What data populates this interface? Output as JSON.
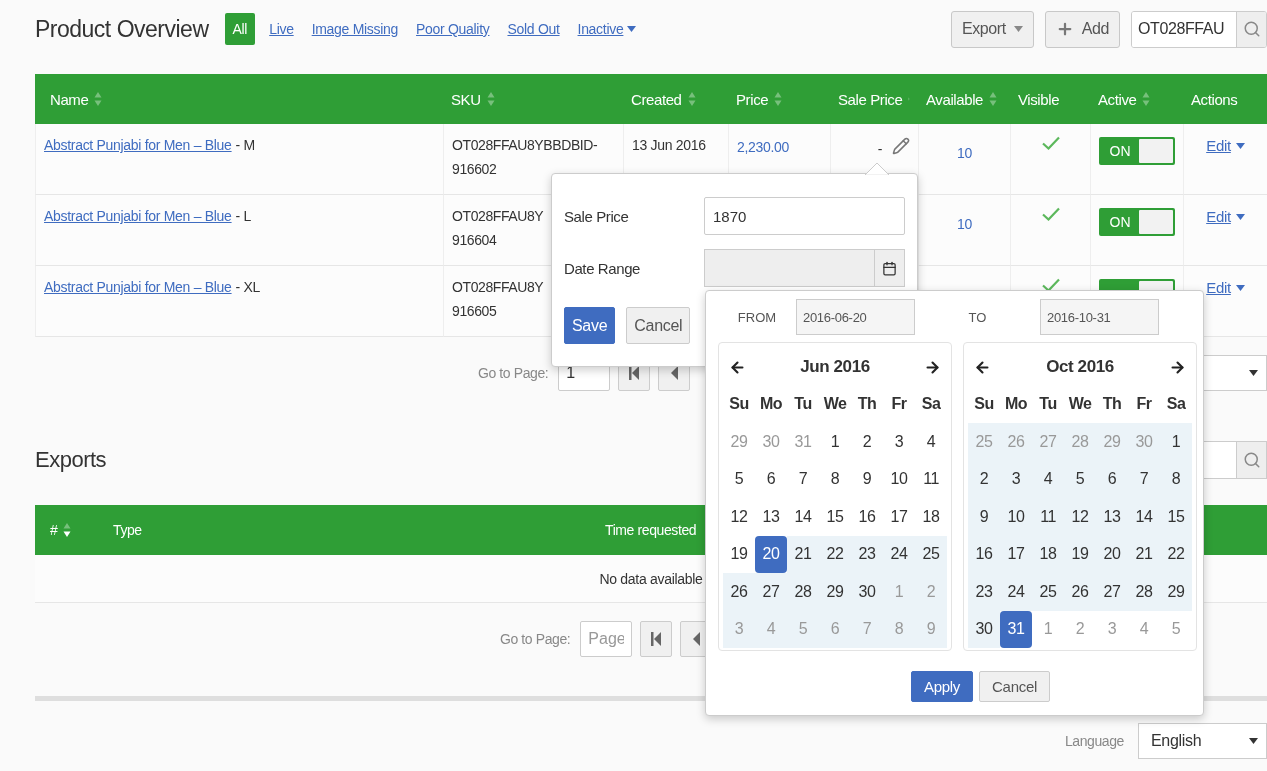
{
  "header": {
    "title": "Product Overview",
    "filters": [
      {
        "label": "All",
        "selected": true,
        "menu": false
      },
      {
        "label": "Live",
        "selected": false,
        "menu": false
      },
      {
        "label": "Image Missing",
        "selected": false,
        "menu": false
      },
      {
        "label": "Poor Quality",
        "selected": false,
        "menu": false
      },
      {
        "label": "Sold Out",
        "selected": false,
        "menu": false
      },
      {
        "label": "Inactive",
        "selected": false,
        "menu": true
      }
    ],
    "actions": [
      {
        "label": "Export",
        "kind": "dropdown"
      },
      {
        "label": "Add",
        "kind": "add"
      }
    ],
    "search": {
      "value": "OT028FFAU"
    }
  },
  "products": {
    "columns": [
      {
        "label": "Name",
        "sortable": true
      },
      {
        "label": "SKU",
        "sortable": true
      },
      {
        "label": "Created",
        "sortable": true
      },
      {
        "label": "Price",
        "sortable": true
      },
      {
        "label": "Sale Price",
        "sortable": true
      },
      {
        "label": "Available",
        "sortable": true
      },
      {
        "label": "Visible",
        "sortable": false
      },
      {
        "label": "Active",
        "sortable": true
      },
      {
        "label": "Actions",
        "sortable": false
      }
    ],
    "rows": [
      {
        "name": "Abstract Punjabi for Men – Blue",
        "size": "- M",
        "sku": [
          "OT028FFAU8YBBDBID-",
          "916602"
        ],
        "created": "13 Jun 2016",
        "price": "2,230.00",
        "sale_price": "-",
        "available": "10",
        "visible": true,
        "active": true,
        "active_label": "ON",
        "action": "Edit"
      },
      {
        "name": "Abstract Punjabi for Men – Blue",
        "size": "- L",
        "sku": [
          "OT028FFAU8Y",
          "916604"
        ],
        "available": "10",
        "visible": true,
        "active": true,
        "active_label": "ON",
        "action": "Edit"
      },
      {
        "name": "Abstract Punjabi for Men – Blue",
        "size": "- XL",
        "sku": [
          "OT028FFAU8Y",
          "916605"
        ],
        "visible": true,
        "active": true,
        "action": "Edit"
      }
    ],
    "pagination": {
      "label": "Go to Page:",
      "value": "1"
    }
  },
  "exports": {
    "title": "Exports",
    "columns": [
      {
        "label": "#",
        "sortable": true,
        "sorted_desc": true
      },
      {
        "label": "Type",
        "sortable": false
      },
      {
        "label": "Time requested",
        "sortable": false
      }
    ],
    "empty": "No data available",
    "pagination": {
      "label": "Go to Page:",
      "placeholder": "Page"
    }
  },
  "footer": {
    "label": "Language",
    "value": "English"
  },
  "sale_popover": {
    "fields": [
      {
        "label": "Sale Price",
        "kind": "text",
        "value": "1870"
      },
      {
        "label": "Date Range",
        "kind": "date"
      }
    ],
    "buttons": [
      {
        "label": "Save",
        "kind": "primary"
      },
      {
        "label": "Cancel",
        "kind": "default"
      }
    ]
  },
  "datepicker": {
    "from_label": "FROM",
    "from": "2016-06-20",
    "to_label": "TO",
    "to": "2016-10-31",
    "calendars": [
      {
        "title": "Jun 2016",
        "weekdays": [
          "Su",
          "Mo",
          "Tu",
          "We",
          "Th",
          "Fr",
          "Sa"
        ],
        "weeks": [
          [
            {
              "day": "29",
              "muted": true,
              "in_range": false,
              "selected": false
            },
            {
              "day": "30",
              "muted": true,
              "in_range": false,
              "selected": false
            },
            {
              "day": "31",
              "muted": true,
              "in_range": false,
              "selected": false
            },
            {
              "day": "1",
              "muted": false,
              "in_range": false,
              "selected": false
            },
            {
              "day": "2",
              "muted": false,
              "in_range": false,
              "selected": false
            },
            {
              "day": "3",
              "muted": false,
              "in_range": false,
              "selected": false
            },
            {
              "day": "4",
              "muted": false,
              "in_range": false,
              "selected": false
            }
          ],
          [
            {
              "day": "5",
              "muted": false,
              "in_range": false,
              "selected": false
            },
            {
              "day": "6",
              "muted": false,
              "in_range": false,
              "selected": false
            },
            {
              "day": "7",
              "muted": false,
              "in_range": false,
              "selected": false
            },
            {
              "day": "8",
              "muted": false,
              "in_range": false,
              "selected": false
            },
            {
              "day": "9",
              "muted": false,
              "in_range": false,
              "selected": false
            },
            {
              "day": "10",
              "muted": false,
              "in_range": false,
              "selected": false
            },
            {
              "day": "11",
              "muted": false,
              "in_range": false,
              "selected": false
            }
          ],
          [
            {
              "day": "12",
              "muted": false,
              "in_range": false,
              "selected": false
            },
            {
              "day": "13",
              "muted": false,
              "in_range": false,
              "selected": false
            },
            {
              "day": "14",
              "muted": false,
              "in_range": false,
              "selected": false
            },
            {
              "day": "15",
              "muted": false,
              "in_range": false,
              "selected": false
            },
            {
              "day": "16",
              "muted": false,
              "in_range": false,
              "selected": false
            },
            {
              "day": "17",
              "muted": false,
              "in_range": false,
              "selected": false
            },
            {
              "day": "18",
              "muted": false,
              "in_range": false,
              "selected": false
            }
          ],
          [
            {
              "day": "19",
              "muted": false,
              "in_range": false,
              "selected": false
            },
            {
              "day": "20",
              "muted": false,
              "in_range": true,
              "selected": true
            },
            {
              "day": "21",
              "muted": false,
              "in_range": true,
              "selected": false
            },
            {
              "day": "22",
              "muted": false,
              "in_range": true,
              "selected": false
            },
            {
              "day": "23",
              "muted": false,
              "in_range": true,
              "selected": false
            },
            {
              "day": "24",
              "muted": false,
              "in_range": true,
              "selected": false
            },
            {
              "day": "25",
              "muted": false,
              "in_range": true,
              "selected": false
            }
          ],
          [
            {
              "day": "26",
              "muted": false,
              "in_range": true,
              "selected": false
            },
            {
              "day": "27",
              "muted": false,
              "in_range": true,
              "selected": false
            },
            {
              "day": "28",
              "muted": false,
              "in_range": true,
              "selected": false
            },
            {
              "day": "29",
              "muted": false,
              "in_range": true,
              "selected": false
            },
            {
              "day": "30",
              "muted": false,
              "in_range": true,
              "selected": false
            },
            {
              "day": "1",
              "muted": true,
              "in_range": true,
              "selected": false
            },
            {
              "day": "2",
              "muted": true,
              "in_range": true,
              "selected": false
            }
          ],
          [
            {
              "day": "3",
              "muted": true,
              "in_range": true,
              "selected": false
            },
            {
              "day": "4",
              "muted": true,
              "in_range": true,
              "selected": false
            },
            {
              "day": "5",
              "muted": true,
              "in_range": true,
              "selected": false
            },
            {
              "day": "6",
              "muted": true,
              "in_range": true,
              "selected": false
            },
            {
              "day": "7",
              "muted": true,
              "in_range": true,
              "selected": false
            },
            {
              "day": "8",
              "muted": true,
              "in_range": true,
              "selected": false
            },
            {
              "day": "9",
              "muted": true,
              "in_range": true,
              "selected": false
            }
          ]
        ]
      },
      {
        "title": "Oct 2016",
        "weekdays": [
          "Su",
          "Mo",
          "Tu",
          "We",
          "Th",
          "Fr",
          "Sa"
        ],
        "weeks": [
          [
            {
              "day": "25",
              "muted": true,
              "in_range": true,
              "selected": false
            },
            {
              "day": "26",
              "muted": true,
              "in_range": true,
              "selected": false
            },
            {
              "day": "27",
              "muted": true,
              "in_range": true,
              "selected": false
            },
            {
              "day": "28",
              "muted": true,
              "in_range": true,
              "selected": false
            },
            {
              "day": "29",
              "muted": true,
              "in_range": true,
              "selected": false
            },
            {
              "day": "30",
              "muted": true,
              "in_range": true,
              "selected": false
            },
            {
              "day": "1",
              "muted": false,
              "in_range": true,
              "selected": false
            }
          ],
          [
            {
              "day": "2",
              "muted": false,
              "in_range": true,
              "selected": false
            },
            {
              "day": "3",
              "muted": false,
              "in_range": true,
              "selected": false
            },
            {
              "day": "4",
              "muted": false,
              "in_range": true,
              "selected": false
            },
            {
              "day": "5",
              "muted": false,
              "in_range": true,
              "selected": false
            },
            {
              "day": "6",
              "muted": false,
              "in_range": true,
              "selected": false
            },
            {
              "day": "7",
              "muted": false,
              "in_range": true,
              "selected": false
            },
            {
              "day": "8",
              "muted": false,
              "in_range": true,
              "selected": false
            }
          ],
          [
            {
              "day": "9",
              "muted": false,
              "in_range": true,
              "selected": false
            },
            {
              "day": "10",
              "muted": false,
              "in_range": true,
              "selected": false
            },
            {
              "day": "11",
              "muted": false,
              "in_range": true,
              "selected": false
            },
            {
              "day": "12",
              "muted": false,
              "in_range": true,
              "selected": false
            },
            {
              "day": "13",
              "muted": false,
              "in_range": true,
              "selected": false
            },
            {
              "day": "14",
              "muted": false,
              "in_range": true,
              "selected": false
            },
            {
              "day": "15",
              "muted": false,
              "in_range": true,
              "selected": false
            }
          ],
          [
            {
              "day": "16",
              "muted": false,
              "in_range": true,
              "selected": false
            },
            {
              "day": "17",
              "muted": false,
              "in_range": true,
              "selected": false
            },
            {
              "day": "18",
              "muted": false,
              "in_range": true,
              "selected": false
            },
            {
              "day": "19",
              "muted": false,
              "in_range": true,
              "selected": false
            },
            {
              "day": "20",
              "muted": false,
              "in_range": true,
              "selected": false
            },
            {
              "day": "21",
              "muted": false,
              "in_range": true,
              "selected": false
            },
            {
              "day": "22",
              "muted": false,
              "in_range": true,
              "selected": false
            }
          ],
          [
            {
              "day": "23",
              "muted": false,
              "in_range": true,
              "selected": false
            },
            {
              "day": "24",
              "muted": false,
              "in_range": true,
              "selected": false
            },
            {
              "day": "25",
              "muted": false,
              "in_range": true,
              "selected": false
            },
            {
              "day": "26",
              "muted": false,
              "in_range": true,
              "selected": false
            },
            {
              "day": "27",
              "muted": false,
              "in_range": true,
              "selected": false
            },
            {
              "day": "28",
              "muted": false,
              "in_range": true,
              "selected": false
            },
            {
              "day": "29",
              "muted": false,
              "in_range": true,
              "selected": false
            }
          ],
          [
            {
              "day": "30",
              "muted": false,
              "in_range": true,
              "selected": false
            },
            {
              "day": "31",
              "muted": false,
              "in_range": true,
              "selected": true
            },
            {
              "day": "1",
              "muted": true,
              "in_range": false,
              "selected": false
            },
            {
              "day": "2",
              "muted": true,
              "in_range": false,
              "selected": false
            },
            {
              "day": "3",
              "muted": true,
              "in_range": false,
              "selected": false
            },
            {
              "day": "4",
              "muted": true,
              "in_range": false,
              "selected": false
            },
            {
              "day": "5",
              "muted": true,
              "in_range": false,
              "selected": false
            }
          ]
        ]
      }
    ],
    "buttons": [
      {
        "label": "Apply",
        "kind": "primary"
      },
      {
        "label": "Cancel",
        "kind": "default"
      }
    ]
  }
}
